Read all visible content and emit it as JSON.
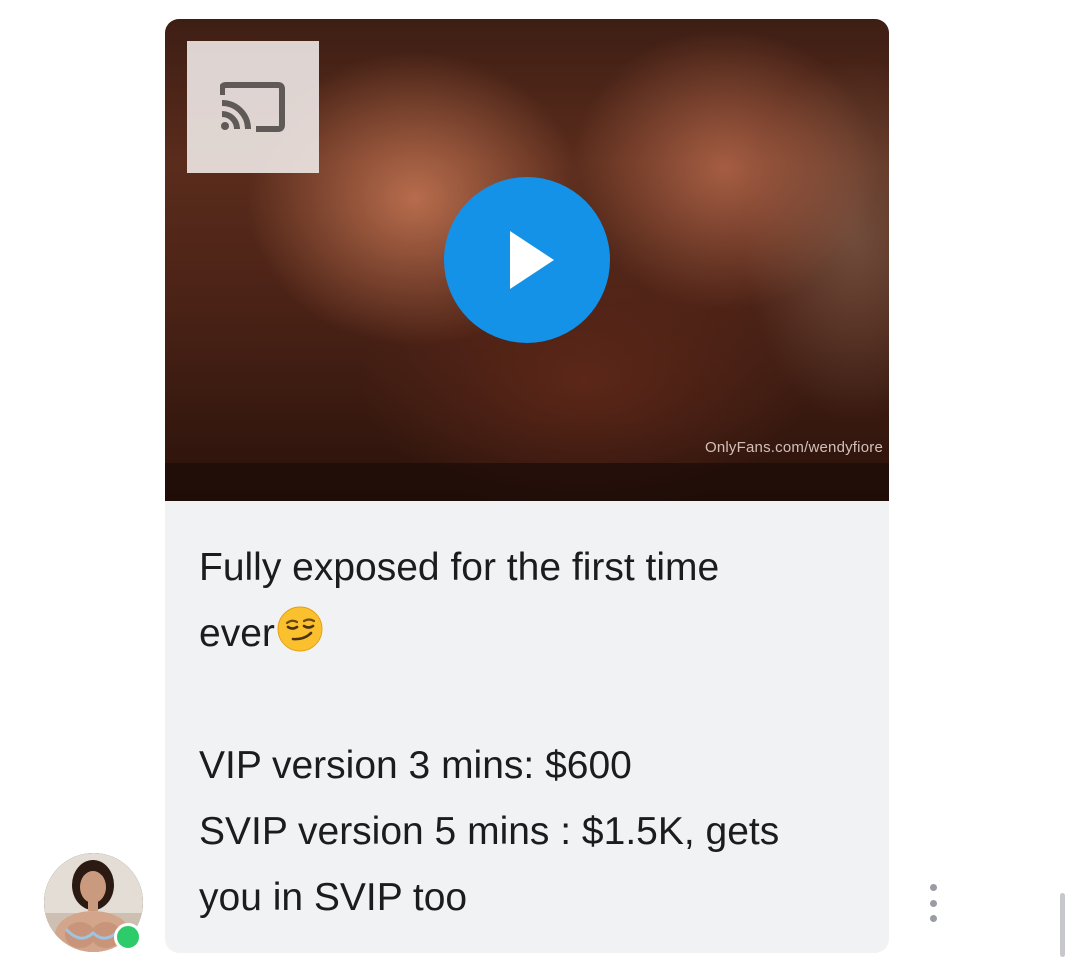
{
  "message": {
    "video": {
      "watermark": "OnlyFans.com/wendyfiore",
      "cast_icon": "cast-icon",
      "play_icon": "play-icon"
    },
    "caption": {
      "line1": "Fully exposed for the first time",
      "line2": "ever",
      "emoji": "smirking-face-emoji",
      "line3": "VIP version 3 mins: $600",
      "line4": "SVIP version 5 mins : $1.5K, gets",
      "line5": "you in SVIP too"
    }
  },
  "sender": {
    "status": "online",
    "status_color": "#2ecb6a"
  },
  "colors": {
    "play_button": "#1392e8",
    "bubble_background": "#f1f2f4"
  },
  "actions": {
    "more_icon": "more-vertical-icon"
  }
}
